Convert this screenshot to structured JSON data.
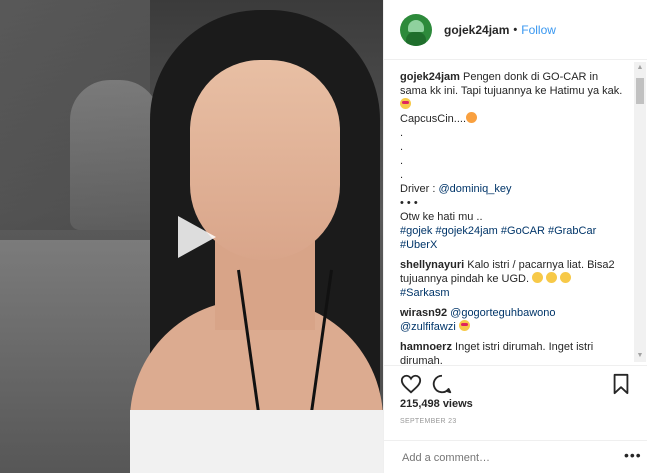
{
  "post": {
    "username": "gojek24jam",
    "separator": "•",
    "follow_label": "Follow"
  },
  "caption": {
    "username": "gojek24jam",
    "line1": "Pengen donk di GO-CAR in sama kk ini. Tapi tujuannya ke Hatimu ya kak.",
    "line2": "CapcusCin....",
    "dots": [
      ".",
      ".",
      ".",
      "."
    ],
    "driver_label": "Driver :",
    "driver_handle": "@dominiq_key",
    "dots2": "• • •",
    "line3": "Otw ke hati mu ..",
    "hashtags": "#gojek #gojek24jam #GoCAR #GrabCar #UberX"
  },
  "comments": [
    {
      "user": "shellynayuri",
      "text": "Kalo istri / pacarnya liat. Bisa2 tujuannya pindah ke UGD.",
      "tag": "#Sarkasm"
    },
    {
      "user": "wirasn92",
      "mention1": "@gogorteguhbawono",
      "mention2": "@zulfifawzi"
    },
    {
      "user": "hamnoerz",
      "text": "Inget istri dirumah. Inget istri dirumah."
    }
  ],
  "stats": {
    "views": "215,498 views",
    "date": "SEPTEMBER 23"
  },
  "add_comment": {
    "placeholder": "Add a comment…",
    "more": "•••"
  },
  "icons": {
    "play": "play-icon",
    "like": "heart-icon",
    "comment": "comment-icon",
    "save": "bookmark-icon"
  },
  "colors": {
    "link": "#3897f0",
    "hashtag": "#003569",
    "avatar": "#2d8a3b"
  }
}
